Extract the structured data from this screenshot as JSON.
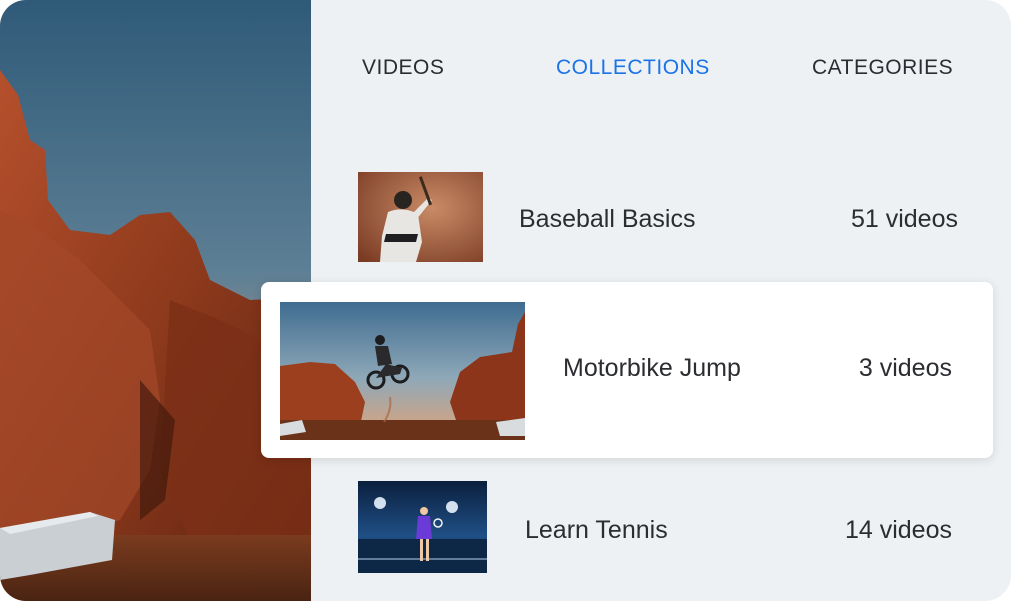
{
  "tabs": {
    "videos": "VIDEOS",
    "collections": "COLLECTIONS",
    "categories": "CATEGORIES",
    "active": "collections"
  },
  "collections": [
    {
      "title": "Baseball Basics",
      "count": "51 videos",
      "thumbnail": "baseball-player-image"
    },
    {
      "title": "Motorbike Jump",
      "count": "3 videos",
      "thumbnail": "motorbike-jump-image",
      "selected": true
    },
    {
      "title": "Learn Tennis",
      "count": "14 videos",
      "thumbnail": "tennis-player-image"
    }
  ],
  "hero": {
    "image": "desert-canyon-image"
  },
  "colors": {
    "accent": "#1a73e8",
    "text": "#2b2d31",
    "panel_bg": "#eef1f3",
    "card_bg": "#ffffff"
  }
}
